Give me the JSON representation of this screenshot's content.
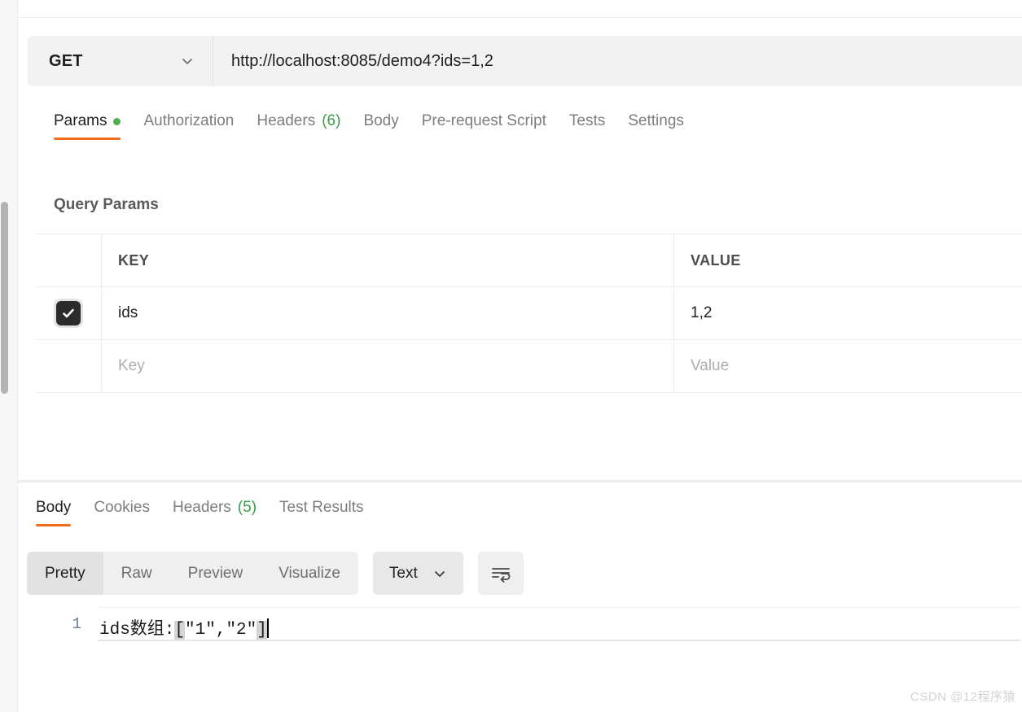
{
  "request": {
    "method": "GET",
    "method_chevron_icon": "chevron-down-icon",
    "url": "http://localhost:8085/demo4?ids=1,2",
    "tabs": [
      {
        "label": "Params",
        "active": true,
        "dot": true
      },
      {
        "label": "Authorization",
        "active": false
      },
      {
        "label": "Headers",
        "count": "(6)",
        "active": false
      },
      {
        "label": "Body",
        "active": false
      },
      {
        "label": "Pre-request Script",
        "active": false
      },
      {
        "label": "Tests",
        "active": false
      },
      {
        "label": "Settings",
        "active": false
      }
    ],
    "params_section_title": "Query Params",
    "table": {
      "columns": {
        "key": "KEY",
        "value": "VALUE"
      },
      "rows": [
        {
          "checked": true,
          "key": "ids",
          "value": "1,2"
        },
        {
          "checked": false,
          "key_placeholder": "Key",
          "value_placeholder": "Value"
        }
      ]
    }
  },
  "response": {
    "tabs": [
      {
        "label": "Body",
        "active": true
      },
      {
        "label": "Cookies",
        "active": false
      },
      {
        "label": "Headers",
        "count": "(5)",
        "active": false
      },
      {
        "label": "Test Results",
        "active": false
      }
    ],
    "view_modes": [
      {
        "label": "Pretty",
        "active": true
      },
      {
        "label": "Raw",
        "active": false
      },
      {
        "label": "Preview",
        "active": false
      },
      {
        "label": "Visualize",
        "active": false
      }
    ],
    "format": {
      "label": "Text",
      "chevron_icon": "chevron-down-icon"
    },
    "wrap_button_icon": "word-wrap-icon",
    "body": {
      "line_number": "1",
      "prefix": "ids数组:",
      "open_bracket": "[",
      "content": "\"1\",\"2\"",
      "close_bracket": "]"
    }
  },
  "watermark": "CSDN @12程序猿",
  "colors": {
    "accent_orange": "#f26b21",
    "count_green": "#3a9b47",
    "dot_green": "#4fae4f",
    "line_number": "#6b7f99"
  }
}
